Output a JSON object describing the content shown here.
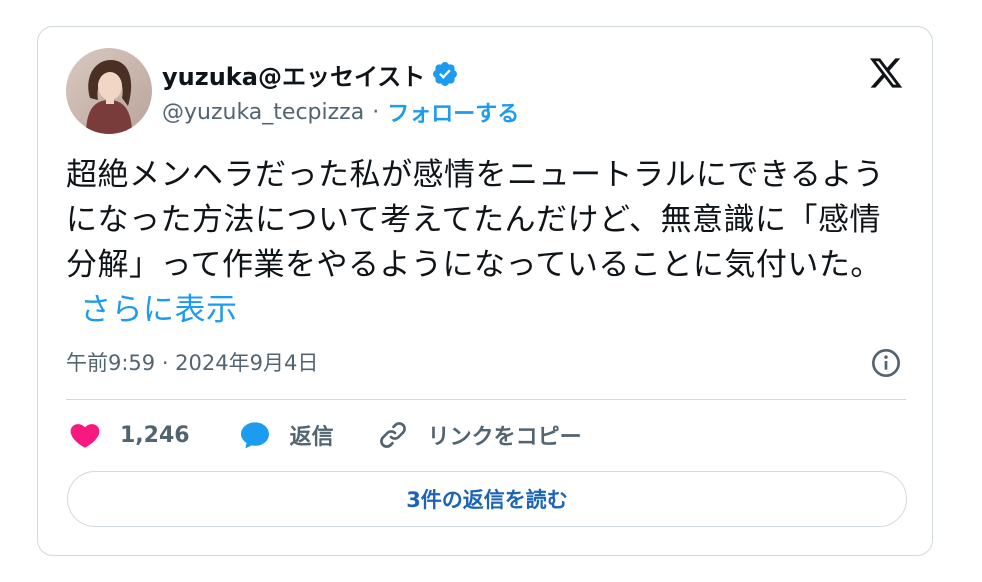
{
  "author": {
    "display_name": "yuzuka@エッセイスト",
    "handle": "@yuzuka_tecpizza",
    "separator": "·",
    "follow_label": "フォローする"
  },
  "tweet": {
    "text": "超絶メンヘラだった私が感情をニュートラルにできるようになった方法について考えてたんだけど、無意識に「感情分解」って作業をやるようになっていることに気付いた。",
    "show_more_label": "さらに表示",
    "timestamp": "午前9:59 · 2024年9月4日"
  },
  "actions": {
    "like_count": "1,246",
    "reply_label": "返信",
    "copy_link_label": "リンクをコピー"
  },
  "read_replies_label": "3件の返信を読む",
  "colors": {
    "accent": "#1d9bf0",
    "like": "#f91880",
    "verified": "#1d9bf0",
    "text": "#0f1419",
    "muted": "#536471",
    "border": "#cfd9de"
  },
  "icons": [
    "avatar",
    "verified-badge-icon",
    "x-logo-icon",
    "info-icon",
    "heart-icon",
    "reply-bubble-icon",
    "link-icon"
  ]
}
